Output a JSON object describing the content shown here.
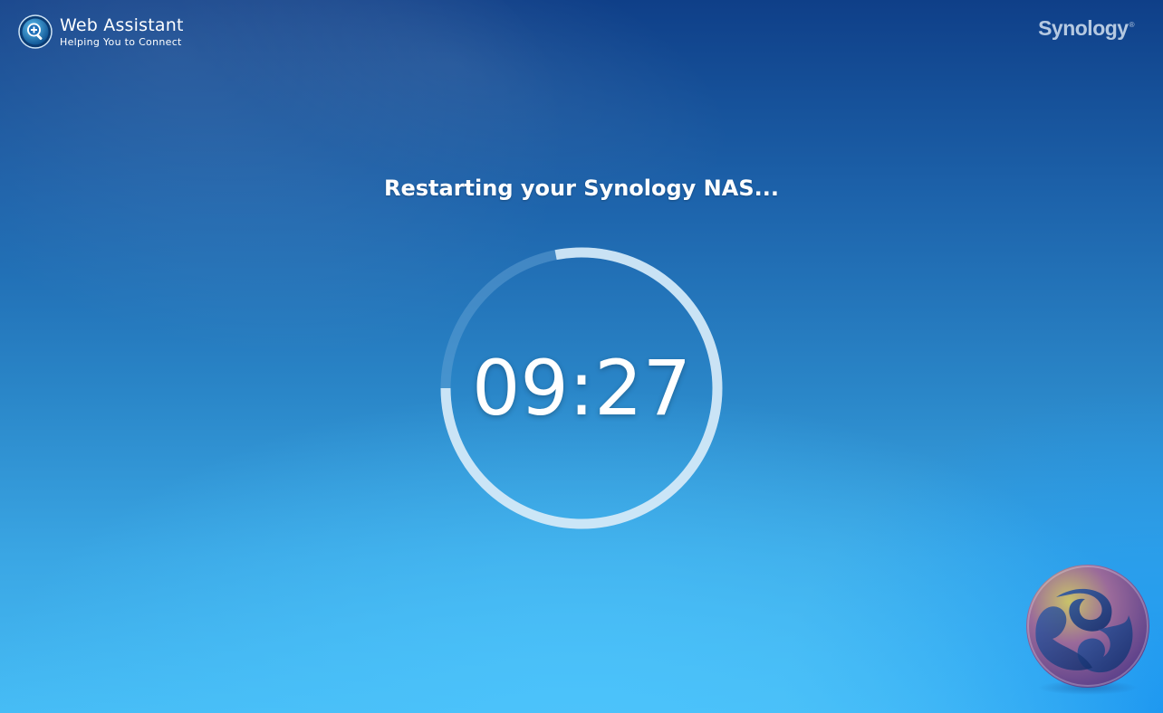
{
  "header": {
    "app_title": "Web Assistant",
    "app_subtitle": "Helping You to Connect",
    "brand_name": "Synology",
    "brand_mark": "®"
  },
  "main": {
    "status_message": "Restarting your Synology NAS...",
    "countdown": "09:27",
    "countdown_progress": 0.78
  },
  "icons": {
    "app_logo": "magnifier-plus-icon",
    "decoration": "dsm-orb-icon"
  },
  "colors": {
    "ring_track": "#6aa6d6",
    "ring_progress": "#d8ecfa",
    "text": "#ffffff"
  }
}
